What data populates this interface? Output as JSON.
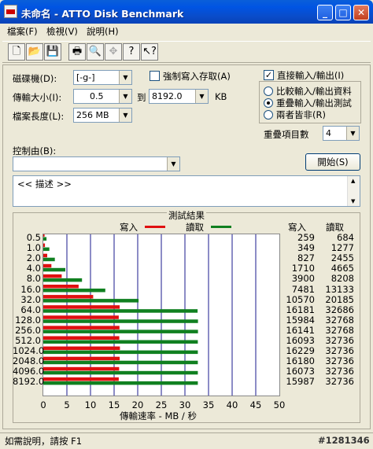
{
  "window": {
    "title": "未命名 - ATTO Disk Benchmark"
  },
  "title_buttons": {
    "minimize": "_",
    "maximize": "□",
    "close": "✕"
  },
  "menu": [
    "檔案(F)",
    "檢視(V)",
    "說明(H)"
  ],
  "toolbar_icons": [
    "new-icon",
    "open-icon",
    "save-icon",
    "print-icon",
    "print-preview-icon",
    "move-icon",
    "help-icon",
    "context-help-icon"
  ],
  "form": {
    "drive_label": "磁碟機(D):",
    "drive_value": "[-g-]",
    "transfer_label": "傳輸大小(I):",
    "transfer_from": "0.5",
    "to_label": "到",
    "transfer_to": "8192.0",
    "unit": "KB",
    "length_label": "檔案長度(L):",
    "length_value": "256 MB",
    "force_write_label": "強制寫入存取(A)",
    "force_write_checked": false,
    "direct_io_label": "直接輸入/輸出(I)",
    "direct_io_checked": true,
    "radio_compare": "比較輸入/輸出資料",
    "radio_overlap": "重疊輸入/輸出測試",
    "radio_neither": "兩者皆非(R)",
    "queue_label": "重疊項目數",
    "queue_value": "4",
    "control_label": "控制由(B):",
    "start_label": "開始(S)",
    "description": "<<   描述   >>"
  },
  "results": {
    "title": "測試結果",
    "legend_write": "寫入",
    "legend_read": "讀取",
    "col_write": "寫入",
    "col_read": "讀取",
    "rows": [
      {
        "size": "0.5",
        "write": "259",
        "read": "684"
      },
      {
        "size": "1.0",
        "write": "349",
        "read": "1277"
      },
      {
        "size": "2.0",
        "write": "827",
        "read": "2455"
      },
      {
        "size": "4.0",
        "write": "1710",
        "read": "4665"
      },
      {
        "size": "8.0",
        "write": "3900",
        "read": "8208"
      },
      {
        "size": "16.0",
        "write": "7481",
        "read": "13133"
      },
      {
        "size": "32.0",
        "write": "10570",
        "read": "20185"
      },
      {
        "size": "64.0",
        "write": "16181",
        "read": "32686"
      },
      {
        "size": "128.0",
        "write": "15984",
        "read": "32768"
      },
      {
        "size": "256.0",
        "write": "16141",
        "read": "32768"
      },
      {
        "size": "512.0",
        "write": "16093",
        "read": "32736"
      },
      {
        "size": "1024.0",
        "write": "16229",
        "read": "32736"
      },
      {
        "size": "2048.0",
        "write": "16180",
        "read": "32736"
      },
      {
        "size": "4096.0",
        "write": "16073",
        "read": "32736"
      },
      {
        "size": "8192.0",
        "write": "15987",
        "read": "32736"
      }
    ],
    "x_ticks": [
      "0",
      "5",
      "10",
      "15",
      "20",
      "25",
      "30",
      "35",
      "40",
      "45",
      "50"
    ],
    "x_label": "傳輸速率 - MB / 秒"
  },
  "chart_data": {
    "type": "bar",
    "categories": [
      "0.5",
      "1.0",
      "2.0",
      "4.0",
      "8.0",
      "16.0",
      "32.0",
      "64.0",
      "128.0",
      "256.0",
      "512.0",
      "1024.0",
      "2048.0",
      "4096.0",
      "8192.0"
    ],
    "series": [
      {
        "name": "寫入",
        "values": [
          0.259,
          0.349,
          0.827,
          1.71,
          3.9,
          7.481,
          10.57,
          16.181,
          15.984,
          16.141,
          16.093,
          16.229,
          16.18,
          16.073,
          15.987
        ]
      },
      {
        "name": "讀取",
        "values": [
          0.684,
          1.277,
          2.455,
          4.665,
          8.208,
          13.133,
          20.185,
          32.686,
          32.768,
          32.768,
          32.736,
          32.736,
          32.736,
          32.736,
          32.736
        ]
      }
    ],
    "title": "測試結果",
    "xlabel": "傳輸速率 - MB / 秒",
    "xlim": [
      0,
      50
    ],
    "colors": {
      "write": "#e01010",
      "read": "#108020"
    }
  },
  "status": {
    "text": "如需說明，請按 F1",
    "watermark": "#1281346"
  }
}
